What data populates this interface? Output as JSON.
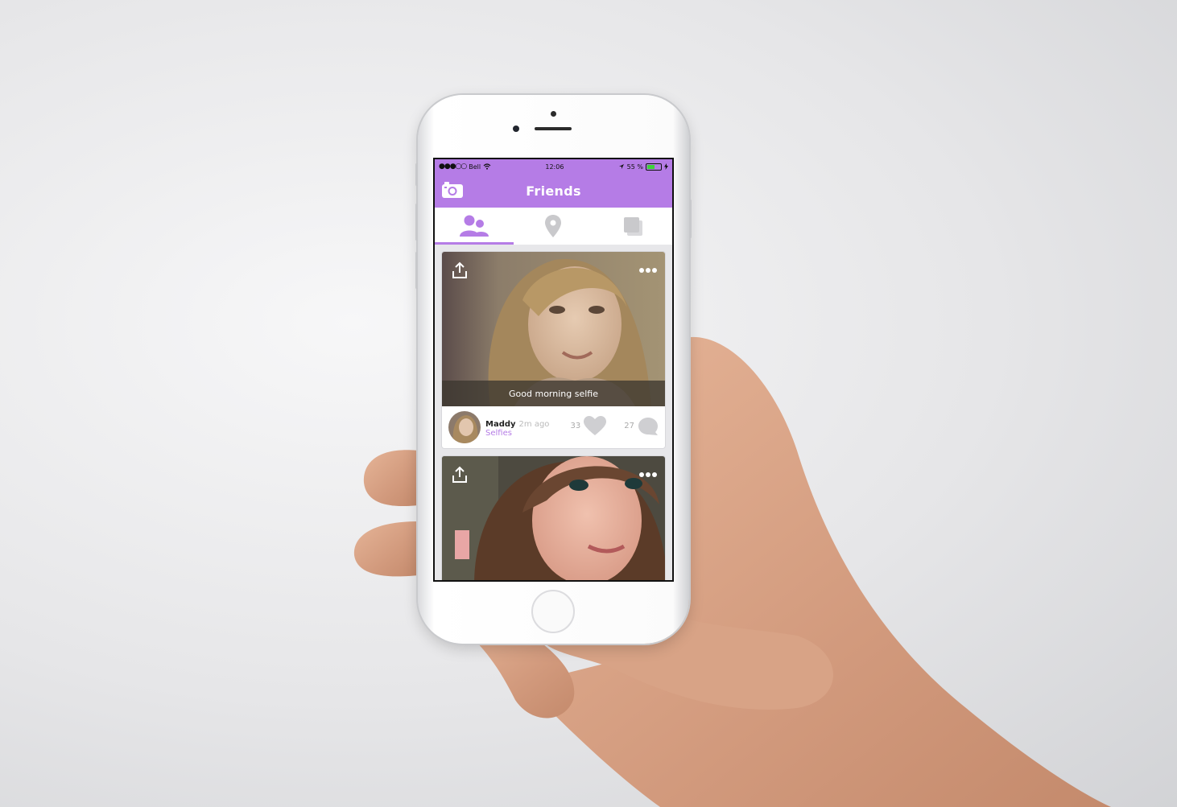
{
  "status_bar": {
    "carrier": "Bell",
    "time": "12:06",
    "battery_label": "55 %",
    "battery_level": 0.55,
    "battery_color": "#3dd23a"
  },
  "header": {
    "title": "Friends",
    "accent_color": "#b57ce6"
  },
  "tabs": [
    {
      "icon": "friends-icon",
      "active": true
    },
    {
      "icon": "location-pin-icon",
      "active": false
    },
    {
      "icon": "stack-icon",
      "active": false
    }
  ],
  "posts": [
    {
      "caption": "Good morning selfie",
      "user": "Maddy",
      "time_ago": "2m ago",
      "category": "Selfies",
      "likes": "33",
      "comments": "27"
    },
    {
      "caption": "",
      "user": "",
      "time_ago": "",
      "category": "",
      "likes": "",
      "comments": ""
    }
  ]
}
